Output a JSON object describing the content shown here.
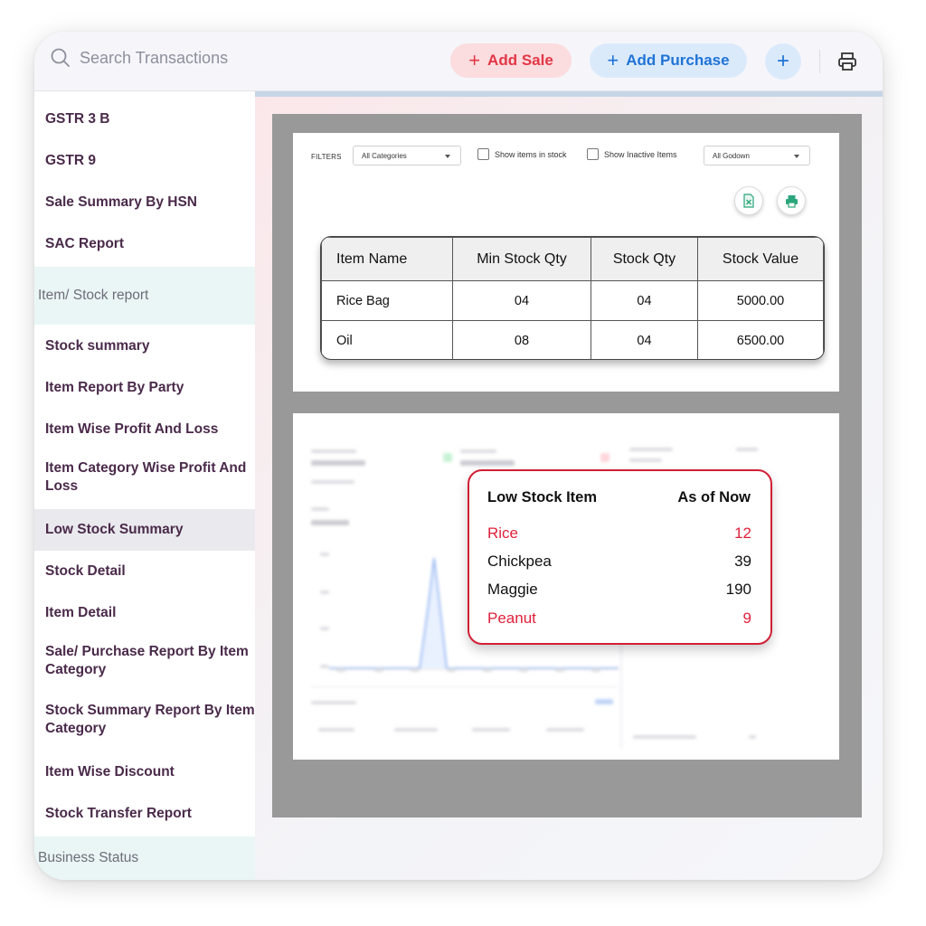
{
  "search": {
    "placeholder": "Search Transactions"
  },
  "header": {
    "add_sale_label": "Add Sale",
    "add_purchase_label": "Add Purchase",
    "plus_symbol": "+"
  },
  "sidebar": {
    "items": [
      {
        "label": "GSTR 3 B",
        "type": "item"
      },
      {
        "label": "GSTR 9",
        "type": "item"
      },
      {
        "label": "Sale Summary By HSN",
        "type": "item"
      },
      {
        "label": "SAC Report",
        "type": "item"
      },
      {
        "label": "Item/ Stock report",
        "type": "section"
      },
      {
        "label": "Stock summary",
        "type": "item"
      },
      {
        "label": "Item Report By Party",
        "type": "item"
      },
      {
        "label": "Item Wise Profit And Loss",
        "type": "item"
      },
      {
        "label": "Item Category Wise Profit And Loss",
        "type": "item"
      },
      {
        "label": "Low Stock Summary",
        "type": "item",
        "active": true
      },
      {
        "label": "Stock Detail",
        "type": "item"
      },
      {
        "label": "Item Detail",
        "type": "item"
      },
      {
        "label": "Sale/ Purchase Report By Item Category",
        "type": "item"
      },
      {
        "label": "Stock Summary Report By Item Category",
        "type": "item"
      },
      {
        "label": "Item Wise Discount",
        "type": "item"
      },
      {
        "label": "Stock Transfer Report",
        "type": "item"
      },
      {
        "label": "Business Status",
        "type": "section"
      }
    ]
  },
  "filters": {
    "label": "FILTERS",
    "category_select": "All Categories",
    "show_in_stock_label": "Show items in stock",
    "show_inactive_label": "Show Inactive Items",
    "godown_select": "All Godown"
  },
  "stock_table": {
    "headers": [
      "Item Name",
      "Min Stock Qty",
      "Stock Qty",
      "Stock Value"
    ],
    "rows": [
      [
        "Rice Bag",
        "04",
        "04",
        "5000.00"
      ],
      [
        "Oil",
        "08",
        "04",
        "6500.00"
      ]
    ]
  },
  "low_stock": {
    "title": "Low Stock Item",
    "as_of": "As of Now",
    "rows": [
      {
        "name": "Rice",
        "qty": "12",
        "alert": true
      },
      {
        "name": "Chickpea",
        "qty": "39",
        "alert": false
      },
      {
        "name": "Maggie",
        "qty": "190",
        "alert": false
      },
      {
        "name": "Peanut",
        "qty": "9",
        "alert": true
      }
    ]
  },
  "colors": {
    "alert_red": "#e0203a",
    "sale_pink": "#fbdcdf",
    "purchase_blue": "#dbeafb",
    "sidebar_text": "#4a2a4a"
  },
  "icons": [
    "search-icon",
    "plus-icon",
    "print-icon",
    "excel-icon"
  ]
}
